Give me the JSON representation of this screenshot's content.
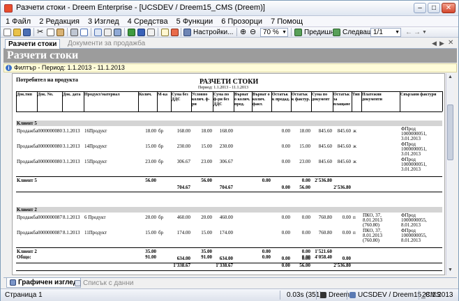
{
  "window": {
    "title": "Разчети стоки - Dreem Enterprise - [UCSDEV / Dreem15_CMS (Dreem)]"
  },
  "menu": [
    "1 Файл",
    "2 Редакция",
    "3 Изглед",
    "4 Средства",
    "5 Функции",
    "6 Прозорци",
    "7 Помощ"
  ],
  "toolbar": {
    "settings_label": "Настройки...",
    "zoom_value": "70 %",
    "prev_label": "Предишна",
    "next_label": "Следваща",
    "page_value": "1/1"
  },
  "tabs": {
    "active": "Разчети стоки",
    "inactive": "Документи за продажба"
  },
  "banner": {
    "title": "Разчети стоки"
  },
  "filter": {
    "text": "Филтър - Период: 1.1.2013 - 11.1.2013"
  },
  "report": {
    "group_label": "Потребител на продукта",
    "title": "РАЗЧЕТИ СТОКИ",
    "period": "Период: 1.1.2013 - 11.1.2013",
    "columns": [
      "Док.тип",
      "Док. No.",
      "Док. дата",
      "Продукт/материал",
      "Колич.",
      "М-ка",
      "Сума без ДДС",
      "Условно колич. ф-ри",
      "Сума по ф-ри без ДДС",
      "Върнат о колич. прод.",
      "Върнат о колич. факт.",
      "Остатък к продад.",
      "Остатък к фактур.",
      "Сума по документ",
      "Остатък за плащане",
      "Тип",
      "Платежни документи",
      "Свързани фактури"
    ],
    "groups": [
      {
        "name": "Клиент 5",
        "rows": [
          {
            "type": "Продажба",
            "no": "0000000080",
            "date": "3.1.2013",
            "product": "16Продукт",
            "qty": "18.00",
            "unit": "бр",
            "sum": "168.00",
            "cqty": "18.00",
            "fsum": "168.00",
            "rem_s": "0.00",
            "rem_f": "18.00",
            "doc_sum": "845.60",
            "rem_pay": "845.60",
            "t": "ж",
            "pay": "",
            "inv": "ФПрод 1000000051, 3.01.2013"
          },
          {
            "type": "Продажба",
            "no": "0000000080",
            "date": "3.1.2013",
            "product": "14Продукт",
            "qty": "15.00",
            "unit": "бр",
            "sum": "230.00",
            "cqty": "15.00",
            "fsum": "230.00",
            "rem_s": "0.00",
            "rem_f": "15.00",
            "doc_sum": "845.60",
            "rem_pay": "845.60",
            "t": "ж",
            "pay": "",
            "inv": "ФПрод 1000000051, 3.01.2013"
          },
          {
            "type": "Продажба",
            "no": "0000000080",
            "date": "3.1.2013",
            "product": "15Продукт",
            "qty": "23.00",
            "unit": "бр",
            "sum": "306.67",
            "cqty": "23.00",
            "fsum": "306.67",
            "rem_s": "0.00",
            "rem_f": "23.00",
            "doc_sum": "845.60",
            "rem_pay": "845.60",
            "t": "ж",
            "pay": "",
            "inv": "ФПрод 1000000051, 3.01.2013"
          }
        ],
        "total": {
          "qty": "56.00",
          "cqty": "56.00",
          "rv1": "0.00",
          "rem_f": "0.00",
          "doc_sum": "2'536.80",
          "sum": "704.67",
          "fsum": "704.67",
          "rv2": "0.00",
          "rem_f2": "56.00",
          "rem_pay": "2'536.80"
        }
      },
      {
        "name": "Клиент 2",
        "rows": [
          {
            "type": "Продажба",
            "no": "0000000087",
            "date": "8.1.2013",
            "product": "6 Продукт",
            "qty": "20.00",
            "unit": "бр",
            "sum": "460.00",
            "cqty": "20.00",
            "fsum": "460.00",
            "rem_s": "0.00",
            "rem_f": "0.00",
            "doc_sum": "760.80",
            "rem_pay": "0.00",
            "t": "п",
            "pay": "ПКО, 37, 8.01.2013 (760.80)",
            "inv": "ФПрод 1000000055, 8.01.2013"
          },
          {
            "type": "Продажба",
            "no": "0000000087",
            "date": "8.1.2013",
            "product": "11Продукт",
            "qty": "15.00",
            "unit": "бр",
            "sum": "174.00",
            "cqty": "15.00",
            "fsum": "174.00",
            "rem_s": "0.00",
            "rem_f": "0.00",
            "doc_sum": "760.80",
            "rem_pay": "0.00",
            "t": "п",
            "pay": "ПКО, 37, 8.01.2013 (760.80)",
            "inv": "ФПрод 1000000055, 8.01.2013"
          }
        ],
        "total": {
          "qty": "35.00",
          "cqty": "35.00",
          "rv1": "0.00",
          "rem_f": "0.00",
          "doc_sum": "1'521.60",
          "sum": "634.00",
          "fsum": "634.00",
          "rv2": "0.00",
          "rem_f2": "0.00",
          "rem_pay": "0.00"
        }
      }
    ],
    "grand": {
      "label": "Общо:",
      "qty": "91.00",
      "cqty": "91.00",
      "rv1": "0.00",
      "rem_f": "0.00",
      "doc_sum": "4'058.40",
      "sum": "1'338.67",
      "fsum": "1'338.67",
      "rv2": "0.00",
      "rem_f2": "56.00",
      "rem_pay": "2'536.80"
    }
  },
  "bottom_tabs": {
    "graphic": "Графичен изглед",
    "list": "Списък с данни"
  },
  "status": {
    "page": "Страница 1",
    "time": "0.03s (351)",
    "app": "Dreem",
    "db": "UCSDEV / Dreem15_CMS",
    "date": "28.1.2013"
  }
}
